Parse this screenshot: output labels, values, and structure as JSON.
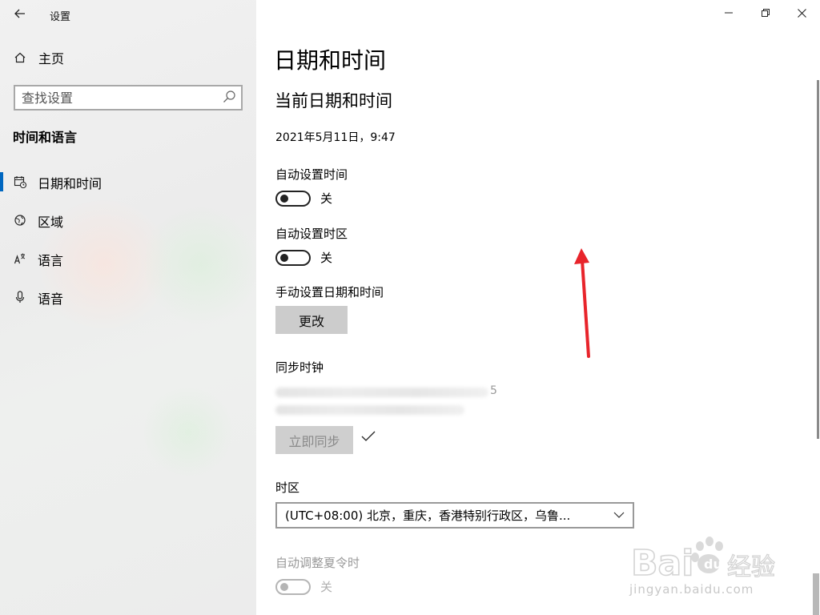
{
  "window": {
    "title": "设置",
    "controls": [
      "minimize-icon",
      "restore-icon",
      "close-icon"
    ]
  },
  "sidebar": {
    "home_label": "主页",
    "search_placeholder": "查找设置",
    "section_heading": "时间和语言",
    "items": [
      {
        "label": "日期和时间",
        "icon": "calendar-clock-icon",
        "selected": true
      },
      {
        "label": "区域",
        "icon": "globe-icon",
        "selected": false
      },
      {
        "label": "语言",
        "icon": "language-icon",
        "selected": false
      },
      {
        "label": "语音",
        "icon": "microphone-icon",
        "selected": false
      }
    ]
  },
  "main": {
    "page_title": "日期和时间",
    "current_section_title": "当前日期和时间",
    "current_datetime": "2021年5月11日，9:47",
    "auto_time": {
      "label": "自动设置时间",
      "state": "关"
    },
    "auto_timezone": {
      "label": "自动设置时区",
      "state": "关"
    },
    "manual": {
      "label": "手动设置日期和时间",
      "button": "更改"
    },
    "sync": {
      "label": "同步时钟",
      "blurred_suffix": "5",
      "button": "立即同步"
    },
    "timezone": {
      "label": "时区",
      "value": "(UTC+08:00) 北京，重庆，香港特别行政区，乌鲁..."
    },
    "dst": {
      "label": "自动调整夏令时",
      "state": "关"
    }
  },
  "watermark": {
    "text": "Bai 经验",
    "sub": "jingyan.baidu.com"
  },
  "colors": {
    "accent": "#0067c0",
    "annotation_arrow": "#e8242b"
  }
}
